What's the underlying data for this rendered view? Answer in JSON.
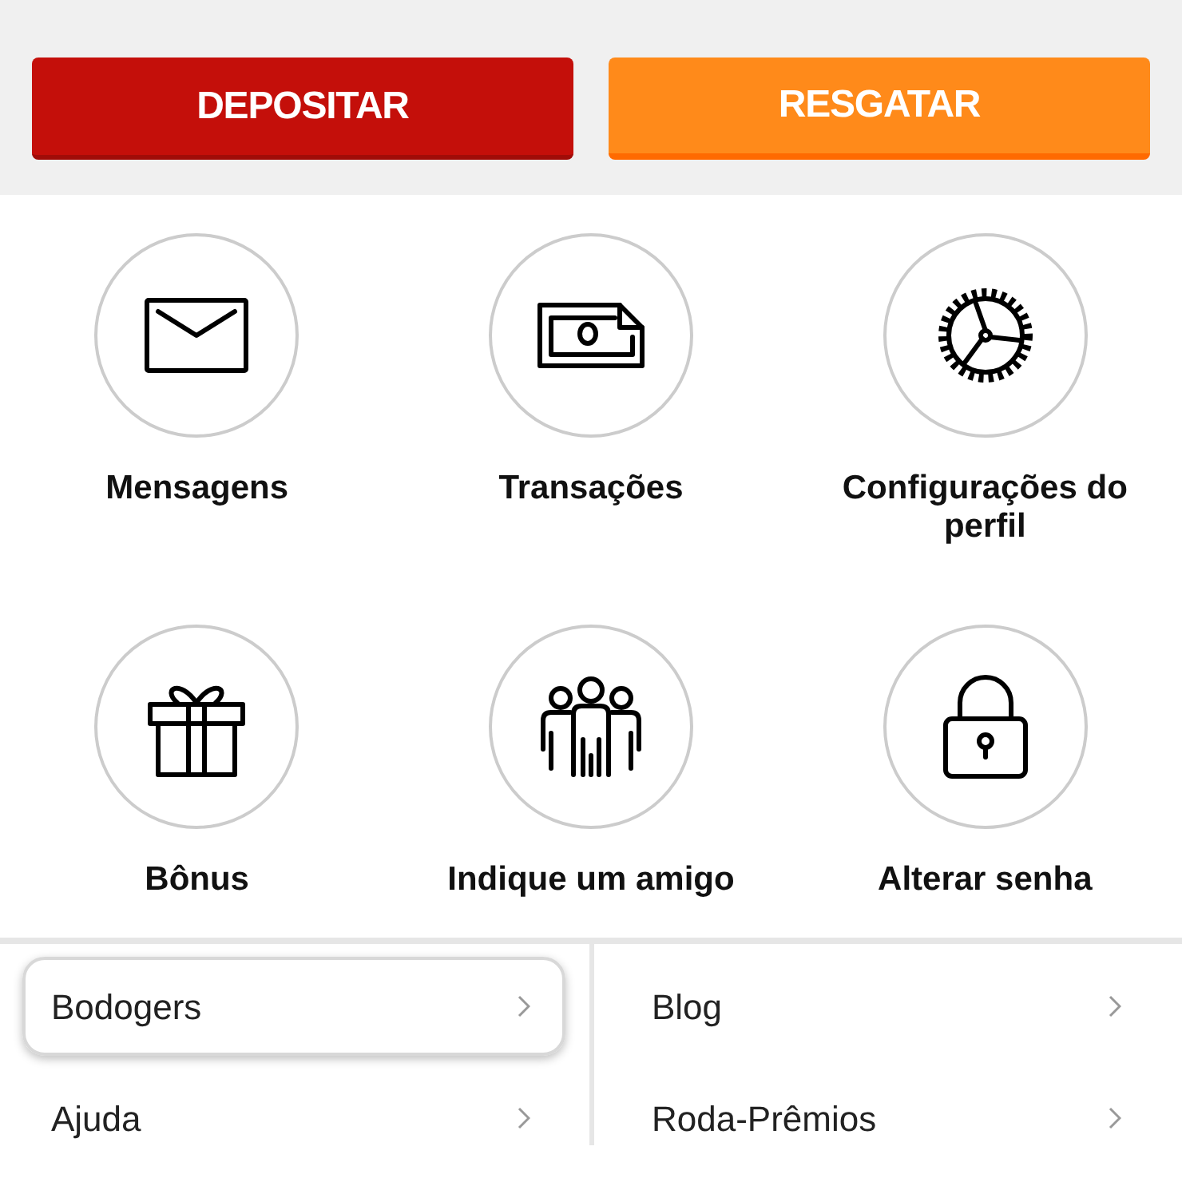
{
  "actions": [
    {
      "label": "DEPOSITAR",
      "kind": "primary"
    },
    {
      "label": "RESGATAR",
      "kind": "secondary"
    }
  ],
  "shortcuts": [
    {
      "label": "Mensagens",
      "kind": "envelope"
    },
    {
      "label": "Transações",
      "kind": "money"
    },
    {
      "label": "Configurações do perfil",
      "kind": "gear"
    },
    {
      "label": "Bônus",
      "kind": "gift"
    },
    {
      "label": "Indique um amigo",
      "kind": "people"
    },
    {
      "label": "Alterar senha",
      "kind": "lock"
    }
  ],
  "links": [
    {
      "label": "Bodogers",
      "selected": true
    },
    {
      "label": "Blog",
      "selected": false
    },
    {
      "label": "Ajuda",
      "selected": false
    },
    {
      "label": "Roda-Prêmios",
      "selected": false
    }
  ]
}
